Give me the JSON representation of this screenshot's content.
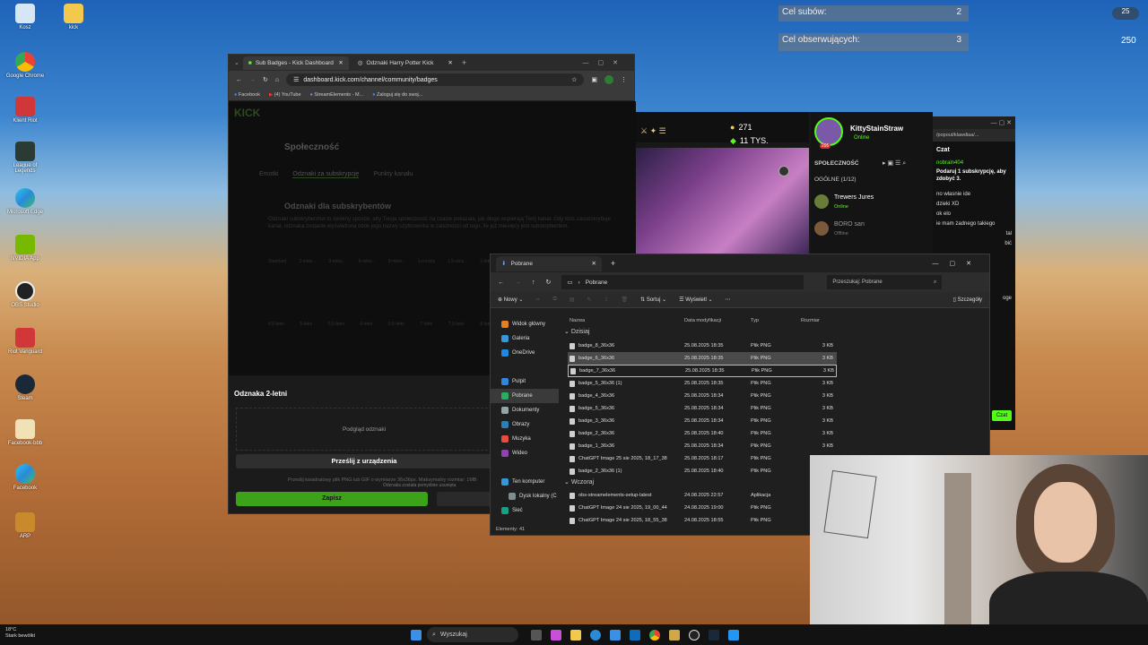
{
  "desktop": {
    "icons": [
      "Kosz",
      "Google Chrome",
      "Klient Riot",
      "League of Legends",
      "Microsoft Edge",
      "NVIDIA App",
      "OBS Studio",
      "Riot Vanguard",
      "Steam",
      "Facebook-bbb",
      "Facebook",
      "ARP"
    ],
    "folder_icon": "kick"
  },
  "overlay": {
    "goal1_label": "Cel subów:",
    "goal1_value": "2",
    "goal2_label": "Cel obserwujących:",
    "goal2_value": "3",
    "corner_value": "250",
    "corner_badge": "25"
  },
  "browser": {
    "tab1": "Sub Badges - Kick Dashboard",
    "tab2": "Odznaki Harry Potter Kick",
    "url": "dashboard.kick.com/channel/community/badges",
    "bookmarks": [
      "Facebook",
      "(4) YouTube",
      "StreamElements - M...",
      "Zaloguj się do swoj..."
    ],
    "logo": "KICK",
    "page_title": "Społeczność",
    "subtabs": [
      "Emotki",
      "Odznaki za subskrypcję",
      "Punkty kanału"
    ],
    "section_title": "Odznaki dla subskrybentów",
    "section_desc": "Odznaki subskrybentów to świetny sposób, aby Twoja społeczność na czacie pokazała, jak długo wspierają Twój kanał. Gdy ktoś zasubskrybuje kanał, odznaka zostanie wyświetlona obok jego nazwy użytkownika w zależności od tego, ile już miesięcy jest subskrybentem.",
    "badge_labels": [
      "Standard",
      "2-mies...",
      "3-mies...",
      "6-mies...",
      "9-mies...",
      "1-roczny",
      "1,5-rocz...",
      "2-letni"
    ],
    "badge_labels2": [
      "4,5-letni",
      "5-letni",
      "5,5-letni",
      "6-letni",
      "6,5-letni",
      "7-letni",
      "7,5-letni",
      "8-letni"
    ],
    "modal_title": "Odznaka 2-letni",
    "preview_label": "Podgląd odznaki",
    "upload_button": "Prześlij z urządzenia",
    "hint": "Prześlij kwadratowy plik PNG lub GIF o wymiarze 36x36px. Maksymalny rozmiar: 1MB",
    "hint2": "Odznaka została pomyślnie usunięta",
    "save_button": "Zapisz"
  },
  "stream": {
    "points": "271",
    "viewers": "11 TYS.",
    "channel": "KittyStainStraw",
    "status": "Online",
    "avatar_num": "295",
    "community_label": "SPOŁECZNOŚĆ",
    "general": "OGÓLNE (1/12)",
    "user1": "Trewers Jures",
    "user1_status": "Online",
    "user2": "BORO san",
    "user2_status": "Offline"
  },
  "chat": {
    "url": "/popout/klawdiaa/...",
    "title": "Czat",
    "lines": [
      "nobrain404",
      "Podaruj 1 subskrypcję, aby zdobyć 3.",
      "no własnie ide",
      "dzieki XD",
      "ok elo",
      "ie mam żadnego takiego",
      "tal",
      "bić",
      "oge"
    ],
    "send": "Czat"
  },
  "explorer": {
    "tab": "Pobrane",
    "path": "Pobrane",
    "search": "Przeszukaj: Pobrane",
    "cmd": {
      "new": "Nowy",
      "sort": "Sortuj",
      "view": "Wyświetl",
      "details": "Szczegóły"
    },
    "nav": [
      "Widok główny",
      "Galeria",
      "OneDrive",
      "Pulpit",
      "Pobrane",
      "Dokumenty",
      "Obrazy",
      "Muzyka",
      "Wideo",
      "Ten komputer",
      "Dysk lokalny (C",
      "Sieć"
    ],
    "headers": [
      "Nazwa",
      "Data modyfikacji",
      "Typ",
      "Rozmiar"
    ],
    "group_today": "Dzisiaj",
    "group_yesterday": "Wczoraj",
    "files_today": [
      {
        "name": "badge_8_36x36",
        "date": "25.08.2025 18:35",
        "type": "Plik PNG",
        "size": "3 KB"
      },
      {
        "name": "badge_6_36x36",
        "date": "25.08.2025 18:35",
        "type": "Plik PNG",
        "size": "3 KB"
      },
      {
        "name": "badge_7_36x36",
        "date": "25.08.2025 18:35",
        "type": "Plik PNG",
        "size": "3 KB"
      },
      {
        "name": "badge_5_36x36 (1)",
        "date": "25.08.2025 18:35",
        "type": "Plik PNG",
        "size": "3 KB"
      },
      {
        "name": "badge_4_36x36",
        "date": "25.08.2025 18:34",
        "type": "Plik PNG",
        "size": "3 KB"
      },
      {
        "name": "badge_5_36x36",
        "date": "25.08.2025 18:34",
        "type": "Plik PNG",
        "size": "3 KB"
      },
      {
        "name": "badge_3_36x36",
        "date": "25.08.2025 18:34",
        "type": "Plik PNG",
        "size": "3 KB"
      },
      {
        "name": "badge_2_36x36",
        "date": "25.08.2025 18:40",
        "type": "Plik PNG",
        "size": "3 KB"
      },
      {
        "name": "badge_1_36x36",
        "date": "25.08.2025 18:34",
        "type": "Plik PNG",
        "size": "3 KB"
      },
      {
        "name": "ChatGPT Image 25 sie 2025, 18_17_38",
        "date": "25.08.2025 18:17",
        "type": "Plik PNG",
        "size": "3 KB"
      },
      {
        "name": "badge_2_36x36 (1)",
        "date": "25.08.2025 18:40",
        "type": "Plik PNG",
        "size": "3 KB"
      }
    ],
    "files_yesterday": [
      {
        "name": "obs-streamelements-setup-latest",
        "date": "24.08.2025 22:57",
        "type": "Aplikacja",
        "size": ""
      },
      {
        "name": "ChatGPT Image 24 sie 2025, 19_00_44",
        "date": "24.08.2025 19:00",
        "type": "Plik PNG",
        "size": ""
      },
      {
        "name": "ChatGPT Image 24 sie 2025, 18_55_38",
        "date": "24.08.2025 18:55",
        "type": "Plik PNG",
        "size": ""
      }
    ],
    "status": "Elementy: 41"
  },
  "taskbar": {
    "weather_temp": "18°C",
    "weather_desc": "Stark bewölkt",
    "search": "Wyszukaj"
  }
}
